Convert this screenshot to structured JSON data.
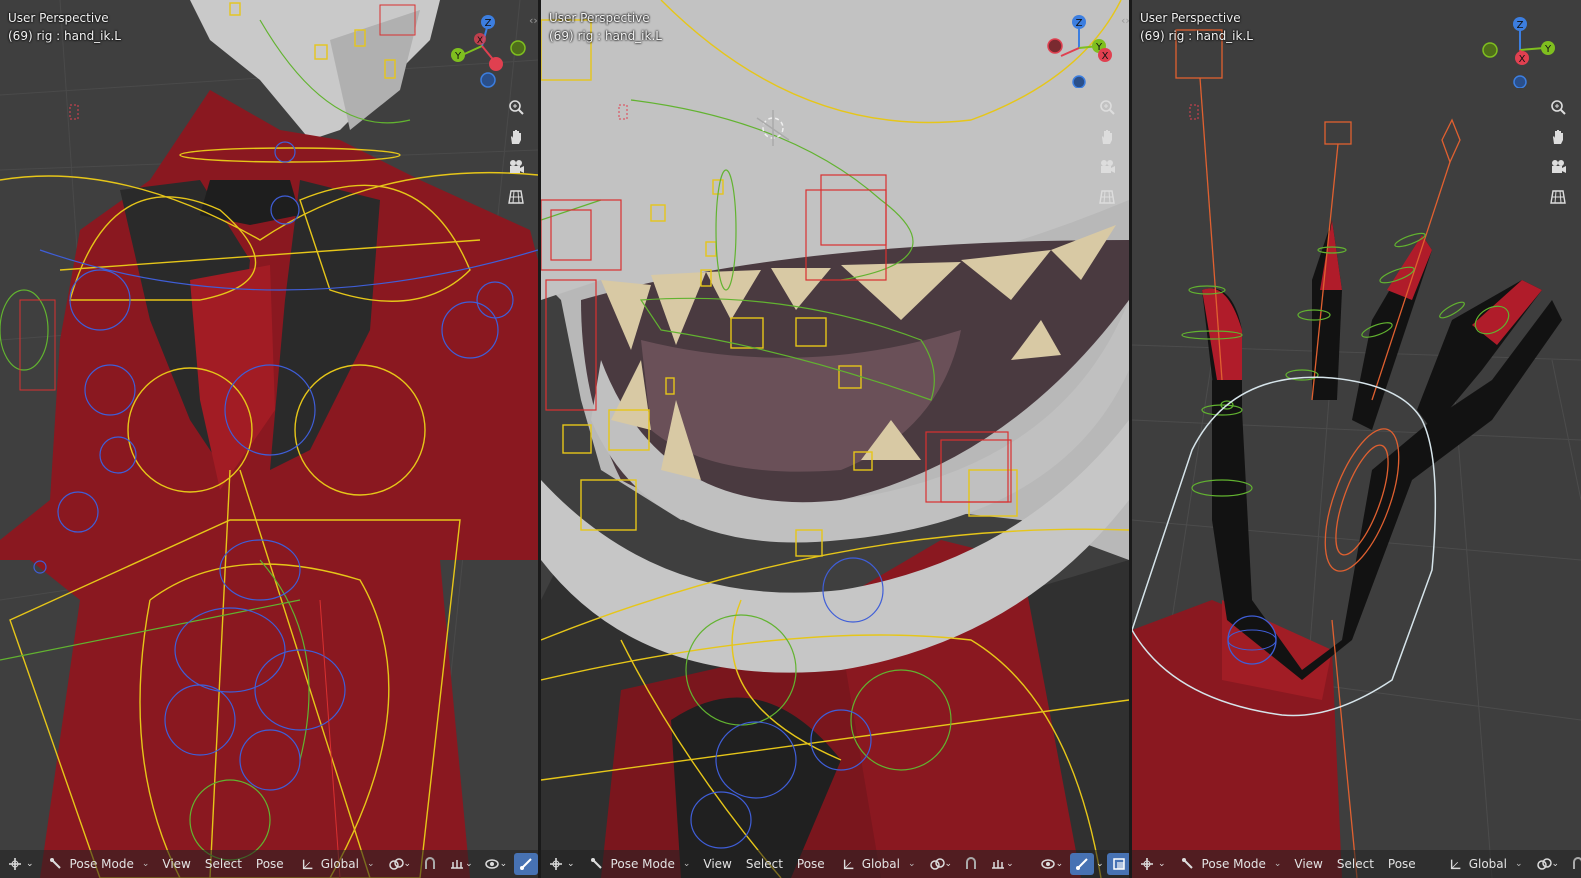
{
  "viewports": [
    {
      "view_name": "User Perspective",
      "object_info": "(69) rig : hand_ik.L",
      "mode_label": "Pose Mode",
      "menus": [
        "View",
        "Select",
        "Pose"
      ],
      "orientation_label": "Global"
    },
    {
      "view_name": "User Perspective",
      "object_info": "(69) rig : hand_ik.L",
      "mode_label": "Pose Mode",
      "menus": [
        "View",
        "Select",
        "Pose"
      ],
      "orientation_label": "Global"
    },
    {
      "view_name": "User Perspective",
      "object_info": "(69) rig : hand_ik.L",
      "mode_label": "Pose Mode",
      "menus": [
        "View",
        "Select",
        "Pose"
      ],
      "orientation_label": "Global"
    }
  ],
  "gizmo_axes": {
    "z": "Z",
    "y": "Y",
    "x": "X"
  },
  "icons": {
    "nav": [
      "zoom-icon",
      "hand-pan-icon",
      "camera-icon",
      "grid-icon"
    ],
    "footer": [
      "object-interaction-icon",
      "pose-mode-icon",
      "orientation-icon",
      "pivot-icon",
      "snap-icon",
      "proportional-icon",
      "overlay-icon",
      "xray-icon"
    ]
  },
  "colors": {
    "axis_x": "#e04050",
    "axis_y": "#7fbf1f",
    "axis_z": "#3c7ee0",
    "bone_yellow": "#e6c619",
    "bone_green": "#62b330",
    "bone_blue": "#3f5ed8",
    "bone_red": "#d93030",
    "suit_red": "#8a1820",
    "highlight": "#4772b3"
  }
}
